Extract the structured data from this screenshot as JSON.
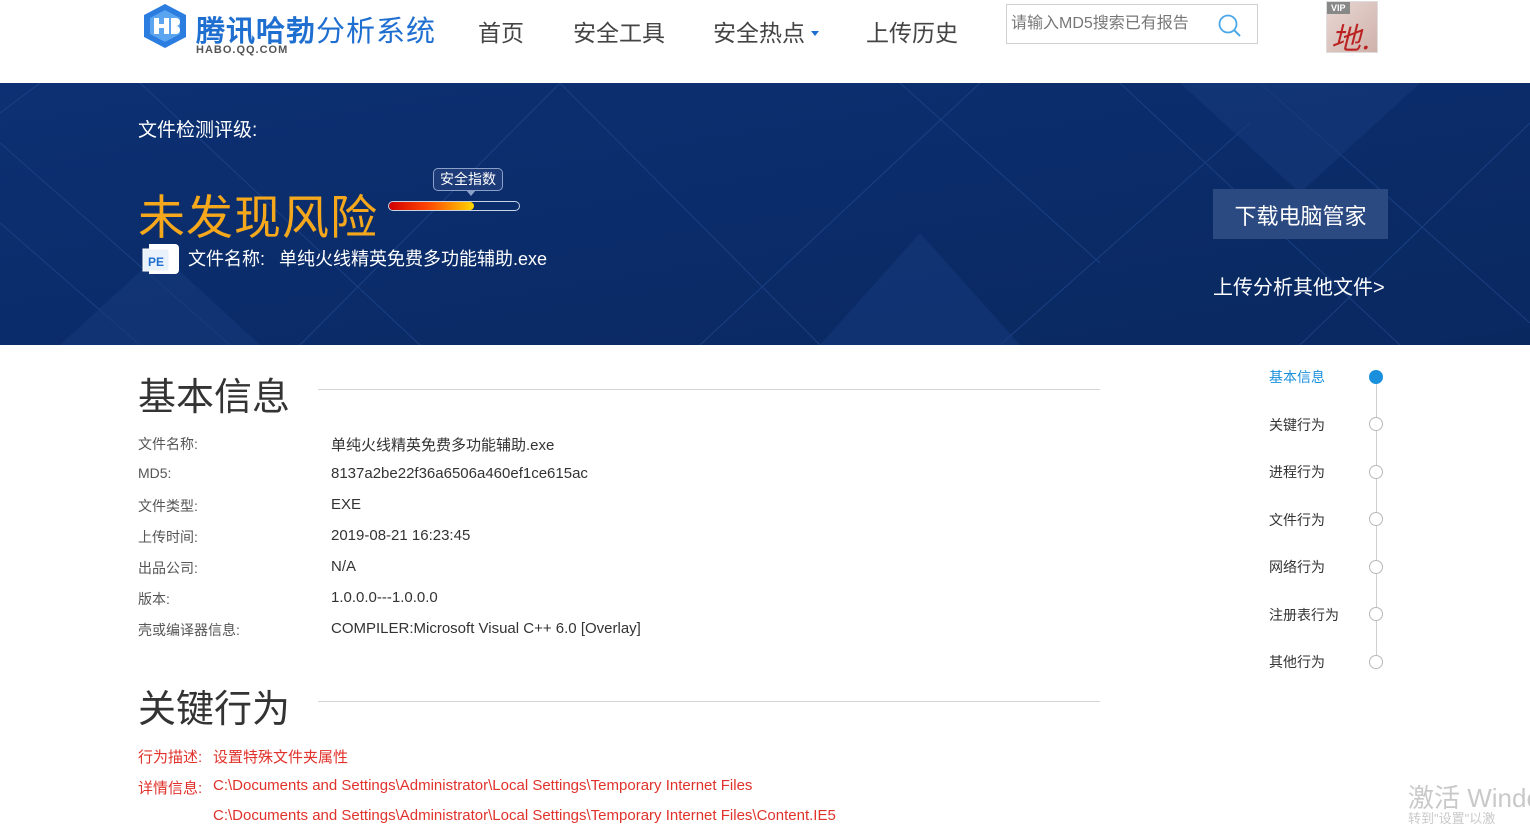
{
  "header": {
    "logo_title": "腾讯哈勃分析系统",
    "logo_title_bold": "腾讯哈勃",
    "logo_title_rest": "分析系统",
    "logo_subtitle": "HABO.QQ.COM",
    "nav": [
      {
        "label": "首页"
      },
      {
        "label": "安全工具"
      },
      {
        "label": "安全热点",
        "has_dropdown": true
      },
      {
        "label": "上传历史"
      }
    ],
    "search_placeholder": "请输入MD5搜索已有报告",
    "avatar_badge": "VIP",
    "avatar_scribble": "地."
  },
  "banner": {
    "rating_label": "文件检测评级:",
    "risk_result": "未发现风险",
    "safety_tag": "安全指数",
    "safety_level": 0.65,
    "file_icon": "PE",
    "filename_label": "文件名称:",
    "filename_value": "单纯火线精英免费多功能辅助.exe",
    "download_button": "下载电脑管家",
    "upload_link": "上传分析其他文件>"
  },
  "basic_info": {
    "title": "基本信息",
    "rows": [
      {
        "label": "文件名称:",
        "value": "单纯火线精英免费多功能辅助.exe"
      },
      {
        "label": "MD5:",
        "value": "8137a2be22f36a6506a460ef1ce615ac"
      },
      {
        "label": "文件类型:",
        "value": "EXE"
      },
      {
        "label": "上传时间:",
        "value": "2019-08-21 16:23:45"
      },
      {
        "label": "出品公司:",
        "value": "N/A"
      },
      {
        "label": "版本:",
        "value": "1.0.0.0---1.0.0.0"
      },
      {
        "label": "壳或编译器信息:",
        "value": "COMPILER:Microsoft Visual C++ 6.0 [Overlay]"
      }
    ]
  },
  "key_behavior": {
    "title": "关键行为",
    "desc_label": "行为描述:",
    "desc_value": "设置特殊文件夹属性",
    "detail_label": "详情信息:",
    "details": [
      "C:\\Documents and Settings\\Administrator\\Local Settings\\Temporary Internet Files",
      "C:\\Documents and Settings\\Administrator\\Local Settings\\Temporary Internet Files\\Content.IE5"
    ]
  },
  "side_nav": {
    "active_index": 0,
    "items": [
      "基本信息",
      "关键行为",
      "进程行为",
      "文件行为",
      "网络行为",
      "注册表行为",
      "其他行为"
    ]
  },
  "watermark": {
    "text": "激活 Windo",
    "sub": "转到\"设置\"以激"
  },
  "colors": {
    "brand_blue": "#1f6fd1",
    "banner_bg": "#0b2d6b",
    "risk_orange": "#f5a81c",
    "behavior_red": "#e0322b",
    "active_blue": "#1a8fdc"
  }
}
